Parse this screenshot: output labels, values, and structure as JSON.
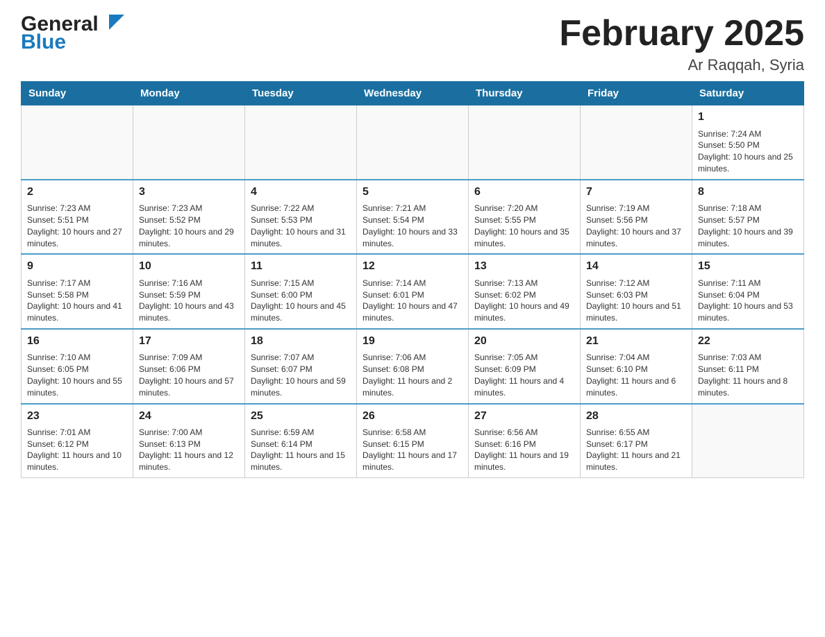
{
  "header": {
    "logo_general": "General",
    "logo_blue": "Blue",
    "month_title": "February 2025",
    "location": "Ar Raqqah, Syria"
  },
  "weekdays": [
    "Sunday",
    "Monday",
    "Tuesday",
    "Wednesday",
    "Thursday",
    "Friday",
    "Saturday"
  ],
  "weeks": [
    [
      {
        "day": "",
        "sunrise": "",
        "sunset": "",
        "daylight": ""
      },
      {
        "day": "",
        "sunrise": "",
        "sunset": "",
        "daylight": ""
      },
      {
        "day": "",
        "sunrise": "",
        "sunset": "",
        "daylight": ""
      },
      {
        "day": "",
        "sunrise": "",
        "sunset": "",
        "daylight": ""
      },
      {
        "day": "",
        "sunrise": "",
        "sunset": "",
        "daylight": ""
      },
      {
        "day": "",
        "sunrise": "",
        "sunset": "",
        "daylight": ""
      },
      {
        "day": "1",
        "sunrise": "Sunrise: 7:24 AM",
        "sunset": "Sunset: 5:50 PM",
        "daylight": "Daylight: 10 hours and 25 minutes."
      }
    ],
    [
      {
        "day": "2",
        "sunrise": "Sunrise: 7:23 AM",
        "sunset": "Sunset: 5:51 PM",
        "daylight": "Daylight: 10 hours and 27 minutes."
      },
      {
        "day": "3",
        "sunrise": "Sunrise: 7:23 AM",
        "sunset": "Sunset: 5:52 PM",
        "daylight": "Daylight: 10 hours and 29 minutes."
      },
      {
        "day": "4",
        "sunrise": "Sunrise: 7:22 AM",
        "sunset": "Sunset: 5:53 PM",
        "daylight": "Daylight: 10 hours and 31 minutes."
      },
      {
        "day": "5",
        "sunrise": "Sunrise: 7:21 AM",
        "sunset": "Sunset: 5:54 PM",
        "daylight": "Daylight: 10 hours and 33 minutes."
      },
      {
        "day": "6",
        "sunrise": "Sunrise: 7:20 AM",
        "sunset": "Sunset: 5:55 PM",
        "daylight": "Daylight: 10 hours and 35 minutes."
      },
      {
        "day": "7",
        "sunrise": "Sunrise: 7:19 AM",
        "sunset": "Sunset: 5:56 PM",
        "daylight": "Daylight: 10 hours and 37 minutes."
      },
      {
        "day": "8",
        "sunrise": "Sunrise: 7:18 AM",
        "sunset": "Sunset: 5:57 PM",
        "daylight": "Daylight: 10 hours and 39 minutes."
      }
    ],
    [
      {
        "day": "9",
        "sunrise": "Sunrise: 7:17 AM",
        "sunset": "Sunset: 5:58 PM",
        "daylight": "Daylight: 10 hours and 41 minutes."
      },
      {
        "day": "10",
        "sunrise": "Sunrise: 7:16 AM",
        "sunset": "Sunset: 5:59 PM",
        "daylight": "Daylight: 10 hours and 43 minutes."
      },
      {
        "day": "11",
        "sunrise": "Sunrise: 7:15 AM",
        "sunset": "Sunset: 6:00 PM",
        "daylight": "Daylight: 10 hours and 45 minutes."
      },
      {
        "day": "12",
        "sunrise": "Sunrise: 7:14 AM",
        "sunset": "Sunset: 6:01 PM",
        "daylight": "Daylight: 10 hours and 47 minutes."
      },
      {
        "day": "13",
        "sunrise": "Sunrise: 7:13 AM",
        "sunset": "Sunset: 6:02 PM",
        "daylight": "Daylight: 10 hours and 49 minutes."
      },
      {
        "day": "14",
        "sunrise": "Sunrise: 7:12 AM",
        "sunset": "Sunset: 6:03 PM",
        "daylight": "Daylight: 10 hours and 51 minutes."
      },
      {
        "day": "15",
        "sunrise": "Sunrise: 7:11 AM",
        "sunset": "Sunset: 6:04 PM",
        "daylight": "Daylight: 10 hours and 53 minutes."
      }
    ],
    [
      {
        "day": "16",
        "sunrise": "Sunrise: 7:10 AM",
        "sunset": "Sunset: 6:05 PM",
        "daylight": "Daylight: 10 hours and 55 minutes."
      },
      {
        "day": "17",
        "sunrise": "Sunrise: 7:09 AM",
        "sunset": "Sunset: 6:06 PM",
        "daylight": "Daylight: 10 hours and 57 minutes."
      },
      {
        "day": "18",
        "sunrise": "Sunrise: 7:07 AM",
        "sunset": "Sunset: 6:07 PM",
        "daylight": "Daylight: 10 hours and 59 minutes."
      },
      {
        "day": "19",
        "sunrise": "Sunrise: 7:06 AM",
        "sunset": "Sunset: 6:08 PM",
        "daylight": "Daylight: 11 hours and 2 minutes."
      },
      {
        "day": "20",
        "sunrise": "Sunrise: 7:05 AM",
        "sunset": "Sunset: 6:09 PM",
        "daylight": "Daylight: 11 hours and 4 minutes."
      },
      {
        "day": "21",
        "sunrise": "Sunrise: 7:04 AM",
        "sunset": "Sunset: 6:10 PM",
        "daylight": "Daylight: 11 hours and 6 minutes."
      },
      {
        "day": "22",
        "sunrise": "Sunrise: 7:03 AM",
        "sunset": "Sunset: 6:11 PM",
        "daylight": "Daylight: 11 hours and 8 minutes."
      }
    ],
    [
      {
        "day": "23",
        "sunrise": "Sunrise: 7:01 AM",
        "sunset": "Sunset: 6:12 PM",
        "daylight": "Daylight: 11 hours and 10 minutes."
      },
      {
        "day": "24",
        "sunrise": "Sunrise: 7:00 AM",
        "sunset": "Sunset: 6:13 PM",
        "daylight": "Daylight: 11 hours and 12 minutes."
      },
      {
        "day": "25",
        "sunrise": "Sunrise: 6:59 AM",
        "sunset": "Sunset: 6:14 PM",
        "daylight": "Daylight: 11 hours and 15 minutes."
      },
      {
        "day": "26",
        "sunrise": "Sunrise: 6:58 AM",
        "sunset": "Sunset: 6:15 PM",
        "daylight": "Daylight: 11 hours and 17 minutes."
      },
      {
        "day": "27",
        "sunrise": "Sunrise: 6:56 AM",
        "sunset": "Sunset: 6:16 PM",
        "daylight": "Daylight: 11 hours and 19 minutes."
      },
      {
        "day": "28",
        "sunrise": "Sunrise: 6:55 AM",
        "sunset": "Sunset: 6:17 PM",
        "daylight": "Daylight: 11 hours and 21 minutes."
      },
      {
        "day": "",
        "sunrise": "",
        "sunset": "",
        "daylight": ""
      }
    ]
  ]
}
